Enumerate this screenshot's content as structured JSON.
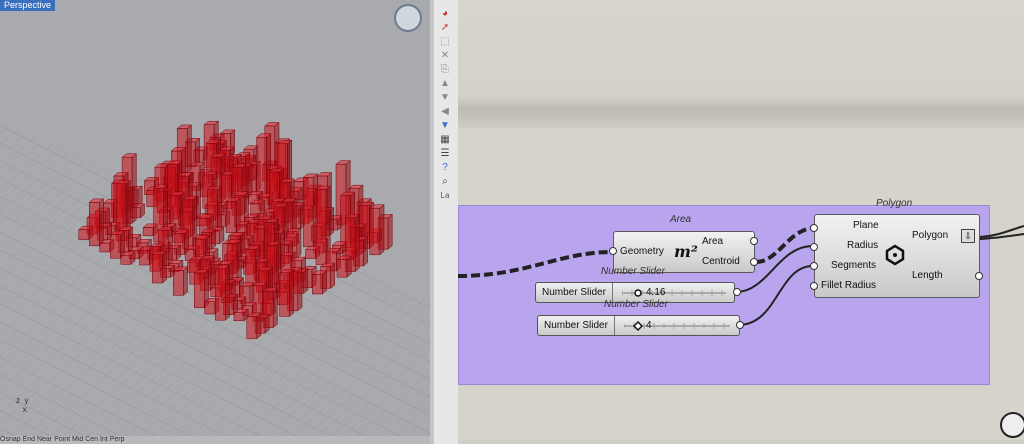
{
  "viewport": {
    "tab_label": "Perspective",
    "axis_label": "z  y\n   x",
    "status_bar": "Osnap  End  Near  Point  Mid  Cen  Int  Perp"
  },
  "toolbar": {
    "icons": [
      "layers-icon",
      "color-wheel-icon",
      "cursor-icon",
      "select-icon",
      "delete-icon",
      "copy-icon",
      "move-icon",
      "rotate-icon",
      "arrow-up-icon",
      "arrow-down-icon",
      "arrow-left-icon",
      "filter-icon",
      "table-icon",
      "list-icon",
      "help-icon",
      "search-icon",
      "layer-label"
    ],
    "layer_text": "La"
  },
  "canvas": {
    "group_fill": "#b9a4ee",
    "area_component": {
      "title": "Area",
      "input": "Geometry",
      "icon_text": "m²",
      "outputs": [
        "Area",
        "Centroid"
      ]
    },
    "polygon_component": {
      "title": "Polygon",
      "inputs": [
        "Plane",
        "Radius",
        "Segments",
        "Fillet Radius"
      ],
      "outputs": [
        "Polygon",
        "Length"
      ]
    },
    "slider1": {
      "title": "Number Slider",
      "label": "Number Slider",
      "value": "4.16",
      "position": 0.12
    },
    "slider2": {
      "title": "Number Slider",
      "label": "Number Slider",
      "value": "4",
      "position": 0.1
    }
  },
  "colors": {
    "geometry_red": "#c8101a",
    "wire": "#222222"
  }
}
